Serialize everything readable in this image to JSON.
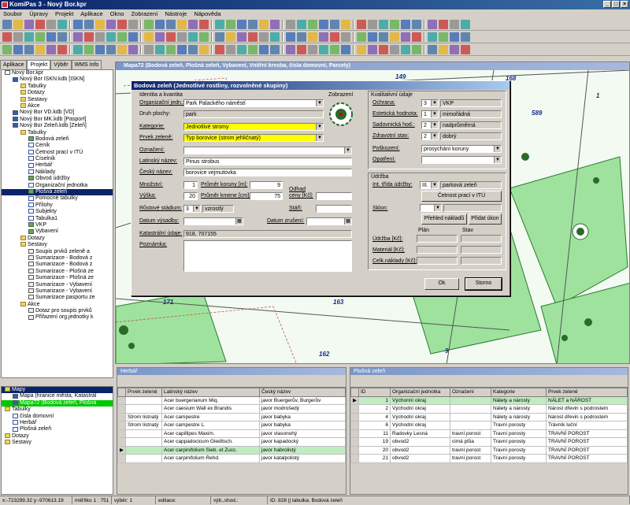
{
  "app_title": "KomiPas 3 - Nový Bor.kpr",
  "menu": [
    "Soubor",
    "Úpravy",
    "Projekt",
    "Aplikace",
    "Okno",
    "Zobrazení",
    "Nástroje",
    "Nápověda"
  ],
  "left_tabs": [
    "Aplikace",
    "Projekt",
    "Výběr",
    "WMS Info"
  ],
  "tree": [
    {
      "label": "Nový Bor.kpr",
      "indent": 0,
      "icon": "project"
    },
    {
      "label": "Nový Bor ISKN.kdb [ISKN]",
      "indent": 1,
      "icon": "db"
    },
    {
      "label": "Tabulky",
      "indent": 2,
      "icon": "folder"
    },
    {
      "label": "Dotazy",
      "indent": 2,
      "icon": "folder"
    },
    {
      "label": "Sestavy",
      "indent": 2,
      "icon": "folder"
    },
    {
      "label": "Akce",
      "indent": 2,
      "icon": "folder"
    },
    {
      "label": "Nový Bor VD.kdb [VD]",
      "indent": 1,
      "icon": "db"
    },
    {
      "label": "Nový Bor MK.kdb [Pasport]",
      "indent": 1,
      "icon": "db"
    },
    {
      "label": "Nový Bor Zeleň.kdb [Zeleň]",
      "indent": 1,
      "icon": "db"
    },
    {
      "label": "Tabulky",
      "indent": 2,
      "icon": "folder"
    },
    {
      "label": "Bodová zeleň",
      "indent": 3,
      "icon": "layer"
    },
    {
      "label": "Ceník",
      "indent": 3,
      "icon": "table"
    },
    {
      "label": "Četnost prací v ITÚ",
      "indent": 3,
      "icon": "table"
    },
    {
      "label": "Číselník",
      "indent": 3,
      "icon": "table"
    },
    {
      "label": "Herbář",
      "indent": 3,
      "icon": "table"
    },
    {
      "label": "Náklady",
      "indent": 3,
      "icon": "table"
    },
    {
      "label": "Obvod údržby",
      "indent": 3,
      "icon": "layer"
    },
    {
      "label": "Organizační jednotka",
      "indent": 3,
      "icon": "table"
    },
    {
      "label": "Plošná zeleň",
      "indent": 3,
      "icon": "layer",
      "selected": true
    },
    {
      "label": "Pomocné tabulky",
      "indent": 3,
      "icon": "table"
    },
    {
      "label": "Přílohy",
      "indent": 3,
      "icon": "table"
    },
    {
      "label": "Subjekty",
      "indent": 3,
      "icon": "table"
    },
    {
      "label": "Tabulka1",
      "indent": 3,
      "icon": "table"
    },
    {
      "label": "VKP",
      "indent": 3,
      "icon": "layer"
    },
    {
      "label": "Vybavení",
      "indent": 3,
      "icon": "layer"
    },
    {
      "label": "Dotazy",
      "indent": 2,
      "icon": "folder"
    },
    {
      "label": "Sestavy",
      "indent": 2,
      "icon": "folder"
    },
    {
      "label": "Soupis prvků zeleně a",
      "indent": 3,
      "icon": "report"
    },
    {
      "label": "Sumarizace - Bodová z",
      "indent": 3,
      "icon": "report"
    },
    {
      "label": "Sumarizace - Bodová z",
      "indent": 3,
      "icon": "report"
    },
    {
      "label": "Sumarizace - Plošná ze",
      "indent": 3,
      "icon": "report"
    },
    {
      "label": "Sumarizace - Plošná ze",
      "indent": 3,
      "icon": "report"
    },
    {
      "label": "Sumarizace - Vybavení",
      "indent": 3,
      "icon": "report"
    },
    {
      "label": "Sumarizace - Vybavení",
      "indent": 3,
      "icon": "report"
    },
    {
      "label": "Sumarizace pasportu ze",
      "indent": 3,
      "icon": "report"
    },
    {
      "label": "Akce",
      "indent": 2,
      "icon": "folder"
    },
    {
      "label": "Dotaz pro soupis prvků",
      "indent": 3,
      "icon": "report"
    },
    {
      "label": "Přiřazení org.jednotky k",
      "indent": 3,
      "icon": "report"
    }
  ],
  "tree2": [
    {
      "label": "Mapy",
      "indent": 0,
      "icon": "folder",
      "selected": true
    },
    {
      "label": "Mapa (hranice města, Katastrál",
      "indent": 1,
      "icon": "map"
    },
    {
      "label": "Mapa72 (Bodová zeleň, Plošná",
      "indent": 1,
      "icon": "map",
      "green": true
    },
    {
      "label": "Tabulky",
      "indent": 0,
      "icon": "folder"
    },
    {
      "label": "čísla domovní",
      "indent": 1,
      "icon": "table"
    },
    {
      "label": "Herbář",
      "indent": 1,
      "icon": "table"
    },
    {
      "label": "Plošná zeleň",
      "indent": 1,
      "icon": "table"
    },
    {
      "label": "Dotazy",
      "indent": 0,
      "icon": "folder"
    },
    {
      "label": "Sestavy",
      "indent": 0,
      "icon": "folder"
    }
  ],
  "map": {
    "title": "Mapa72 (Bodová zeleň, Plošná zeleň, Vybavení, Vnitřní kresba, čísla domovní, Parcely)",
    "numbers": [
      "149",
      "168",
      "589",
      "1",
      "171",
      "163",
      "162",
      "9"
    ]
  },
  "dialog": {
    "title": "Bodová zeleň (Jednotlivé rostliny, rozvolněné skupiny)",
    "identity_header": "Identita a kvantita",
    "org_label": "Organizační jedn.:",
    "org_value": "Park Palackého náměstí",
    "druh_label": "Druh plochy:",
    "druh_value": "park",
    "kategorie_label": "Kategorie:",
    "kategorie_value": "Jednotlivé stromy",
    "prvek_label": "Prvek zeleně:",
    "prvek_value": "Typ borovice  (strom jehličnatý)",
    "oznaceni_label": "Označení:",
    "latin_label": "Latinský název:",
    "latin_value": "Pinus strobus",
    "czech_label": "Český název:",
    "czech_value": "borovice vejmutovka",
    "mnozstvi_label": "Množství:",
    "mnozstvi_value": "1",
    "prumer_koruny_label": "Průměr koruny [m]:",
    "prumer_koruny_value": "9",
    "vyska_label": "Výška:",
    "vyska_value": "20",
    "prumer_kmene_label": "Průměr kmene [cm]:",
    "prumer_kmene_value": "75",
    "odhad_label": "Odhad ceny [Kč]:",
    "rustove_label": "Růstové stádium:",
    "rustove_num": "3",
    "rustove_value": "vzrostlý",
    "stari_label": "Stáří:",
    "datum_vysadby_label": "Datum výsadby:",
    "datum_zruseni_label": "Datum zrušení:",
    "katastr_label": "Katastrální údaje:",
    "katastr_value": "918, 707155",
    "poznamka_label": "Poznámka:",
    "zobrazeni_label": "Zobrazení",
    "kvalit_header": "Kvalitativní údaje",
    "ochrana_label": "Ochrana:",
    "ochrana_num": "3",
    "ochrana_value": "VKP",
    "estet_label": "Estetická hodnota:",
    "estet_num": "1",
    "estet_value": "mimořádná",
    "sadov_label": "Sadovnická hod.:",
    "sadov_num": "2",
    "sadov_value": "nadprůměrná",
    "zdrav_label": "Zdravotní stav:",
    "zdrav_num": "2",
    "zdrav_value": "dobrý",
    "poskoz_label": "Poškození:",
    "poskoz_value": "prosychání koruny",
    "opatreni_label": "Opatření:",
    "udrzba_header": "Údržba",
    "int_label": "Int. třída údržby:",
    "int_num": "III.",
    "int_value": "parková zeleň",
    "cetnost_btn": "Četnost prací v ITÚ",
    "sklon_label": "Sklon:",
    "prehled_btn": "Přehled nákladů",
    "pridat_btn": "Přidat úkon",
    "plan_label": "Plán",
    "stav_label": "Stav",
    "udrzba_kc": "Údržba [Kč]:",
    "material_kc": "Materiál [Kč]:",
    "celk_kc": "Celk.náklady [Kč]:",
    "ok_btn": "Ok",
    "storno_btn": "Storno"
  },
  "herbar": {
    "title": "Herbář",
    "columns": [
      "Prvek zeleně",
      "Latinský název",
      "Český název"
    ],
    "rows": [
      [
        "",
        "Acer buergerianum Miq.",
        "javor Buergerův, Burgerův"
      ],
      [
        "",
        "Acer caesium Wall ex Brandis",
        "javor modrošedý"
      ],
      [
        "Strom listnatý",
        "Acer campestre",
        "javor babyka"
      ],
      [
        "Strom listnatý",
        "Acer campestre L.",
        "javor babyka"
      ],
      [
        "",
        "Acer capillipes Maxim.",
        "javor vlasonohý"
      ],
      [
        "",
        "Acer cappadocicum Gleditsch.",
        "javor kapadocký"
      ],
      [
        "",
        "Acer carpinifolium Sieb. et Zucc.",
        "javor habrolistý"
      ],
      [
        "",
        "Acer carpinifolium Rehd.",
        "javor katalpolistý"
      ]
    ],
    "highlight_row": 6
  },
  "plosna": {
    "title": "Plošná zeleň",
    "columns": [
      "ID",
      "Organizační jednotka",
      "Označení",
      "Kategorie",
      "Prvek zeleně"
    ],
    "rows": [
      [
        "1",
        "Výchonní okraj",
        "",
        "Nálety a nárosty",
        "NÁLET a NÁROST"
      ],
      [
        "2",
        "Východní okraj",
        "",
        "Nálety a nárosty",
        "Nárost dřevin s podrostem"
      ],
      [
        "4",
        "Východní okraj",
        "",
        "Nálety a nárosty",
        "Nárost dřevin s podrostem"
      ],
      [
        "6",
        "Východní okraj",
        "",
        "Travní porosty",
        "Trávník luční"
      ],
      [
        "11",
        "Radovky Lesná",
        "travní porost",
        "Travní porosty",
        "TRAVNÍ POROST"
      ],
      [
        "19",
        "obvod2",
        "cimá plůa",
        "Travní porosty",
        "TRAVNÍ POROST"
      ],
      [
        "20",
        "obvod2",
        "travní porost",
        "Travní porosty",
        "TRAVNÍ POROST"
      ],
      [
        "21",
        "obvod2",
        "travní porost",
        "Travní porosty",
        "TRAVNÍ POROST"
      ]
    ],
    "highlight_row": 0
  },
  "status": [
    "x:-723299.32  y:-970613.19",
    "měřítko 1 : 751",
    "výběr: 1",
    "editace:",
    "výb.,shod.:",
    "ID: 828 || tabulka: Bodová zeleň"
  ],
  "colors": {
    "accent": "#0a246a",
    "highlight_green": "#00c800",
    "field_yellow": "#ffff00",
    "map_green": "#9ee29e"
  }
}
